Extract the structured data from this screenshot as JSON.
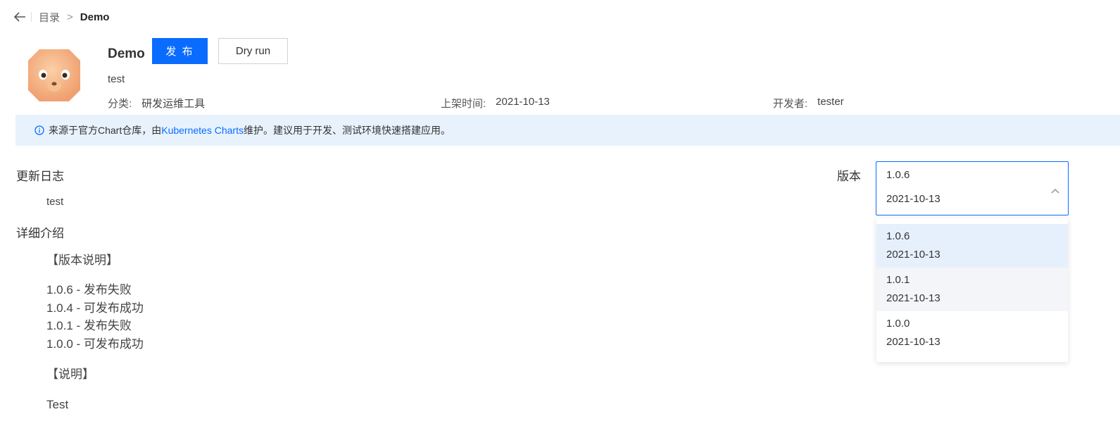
{
  "breadcrumb": {
    "parent": "目录",
    "separator": ">",
    "current": "Demo"
  },
  "app": {
    "name": "Demo",
    "publish_label": "发 布",
    "dryrun_label": "Dry run",
    "description": "test",
    "category_label": "分类:",
    "category_value": "研发运维工具",
    "date_label": "上架时间:",
    "date_value": "2021-10-13",
    "developer_label": "开发者:",
    "developer_value": "tester"
  },
  "notice": {
    "prefix": "来源于官方Chart仓库，由",
    "link": "Kubernetes Charts",
    "suffix": "维护。建议用于开发、测试环境快速搭建应用。"
  },
  "changelog": {
    "title": "更新日志",
    "text": "test"
  },
  "details": {
    "title": "详细介绍",
    "heading1": "【版本说明】",
    "lines": [
      "1.0.6 - 发布失败",
      "1.0.4 - 可发布成功",
      "1.0.1 - 发布失败",
      "1.0.0 - 可发布成功"
    ],
    "heading2": "【说明】",
    "footer": "Test"
  },
  "version": {
    "label": "版本",
    "selected_version": "1.0.6",
    "selected_date": "2021-10-13",
    "options": [
      {
        "version": "1.0.6",
        "date": "2021-10-13"
      },
      {
        "version": "1.0.1",
        "date": "2021-10-13"
      },
      {
        "version": "1.0.0",
        "date": "2021-10-13"
      }
    ]
  },
  "colors": {
    "primary": "#0a6cff",
    "notice_bg": "#e8f2fd",
    "selected_bg": "#e6f0fd"
  },
  "icons": {
    "back": "arrow-left-icon",
    "info": "info-circle-icon",
    "chevron": "chevron-up-icon"
  }
}
